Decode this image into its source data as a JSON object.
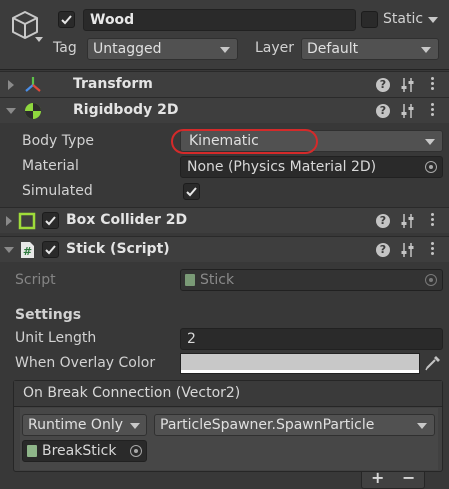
{
  "header": {
    "active": true,
    "name": "Wood",
    "static_label": "Static",
    "static_checked": false,
    "tag_label": "Tag",
    "tag_value": "Untagged",
    "layer_label": "Layer",
    "layer_value": "Default"
  },
  "components": {
    "transform": {
      "title": "Transform"
    },
    "rigidbody": {
      "title": "Rigidbody 2D",
      "body_type_label": "Body Type",
      "body_type_value": "Kinematic",
      "material_label": "Material",
      "material_value": "None (Physics Material 2D)",
      "simulated_label": "Simulated",
      "simulated_checked": true
    },
    "box_collider": {
      "title": "Box Collider 2D",
      "enabled": true
    },
    "stick": {
      "title": "Stick (Script)",
      "enabled": true,
      "script_label": "Script",
      "script_value": "Stick",
      "settings_heading": "Settings",
      "unit_length_label": "Unit Length",
      "unit_length_value": "2",
      "overlay_color_label": "When Overlay Color",
      "overlay_color": "#c8c8c8",
      "event": {
        "title": "On Break Connection (Vector2)",
        "runtime_value": "Runtime Only",
        "function_value": "ParticleSpawner.SpawnParticle",
        "target_value": "BreakStick"
      },
      "add_label": "+",
      "remove_label": "−"
    }
  },
  "colors": {
    "annotation_circle": "#d42a2a",
    "transform_icon_red": "#e04a3a",
    "rigidbody_icon": "#8fd83e",
    "collider_icon": "#9fdc3a"
  }
}
